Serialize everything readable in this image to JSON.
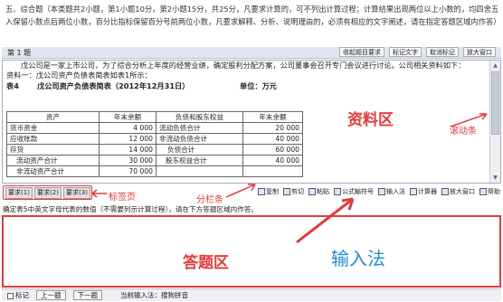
{
  "instructions": "五、综合题（本类题共2小题，第1小题10分，第2小题15分，共25分，凡要求计算的，可不列出计算过程；计算结果出现两位以上小数的，均四舍五入保留小数点后两位小数，百分比指标保留百分号前两位小数，凡要求解释、分析、说明理由的，必须有相应的文字阐述，请在指定答题区域内作答）",
  "question_bar": {
    "title": "第 1 题",
    "tools": [
      "收起题目要求",
      "标记文字",
      "取消标记",
      "放大窗口"
    ]
  },
  "material": {
    "para1": "戊公司是一家上市公司，为了综合分析上年度的经营业绩，确定股利分配方案，公司董事会召开专门会议进行讨论。公司相关资料如下：",
    "para2": "资料一：戊公司资产负债表简表如表1所示：",
    "table_label": "表4",
    "table_title": "戊公司资产负债表简表（2012年12月31日）",
    "table_unit": "单位：万元",
    "header": [
      "资产",
      "年末余额",
      "负债和股东权益",
      "年末余额"
    ],
    "rows": [
      [
        "货币资金",
        "4 000",
        "流动负债合计",
        "20 000"
      ],
      [
        "应收账款",
        "12 000",
        "非流动负债合计",
        "40 000"
      ],
      [
        "存货",
        "14 000",
        "负债合计",
        "60 000"
      ],
      [
        "流动资产合计",
        "30 000",
        "股东权益合计",
        "40 000"
      ],
      [
        "非流动资产合计",
        "70 000",
        "",
        ""
      ]
    ]
  },
  "annotations": {
    "material_area": "资料区",
    "scrollbar": "滚动条",
    "tabs": "标签页",
    "splitter": "分栏条",
    "answer_area": "答题区",
    "ime": "输入法"
  },
  "tabs": [
    "要求(1)",
    "要求(2)",
    "要求(3)"
  ],
  "answer_tools": [
    "复制",
    "剪切",
    "粘贴",
    "公式輸符号",
    "输入法",
    "计算器",
    "放大窗口",
    "帮助"
  ],
  "answer_prompt": "确定表5中英文字母代表的数值（不需要列示计算过程），请在下方答题区域内作答。",
  "status": {
    "mark": "标记",
    "prev": "上一题",
    "next": "下一题",
    "ime_label": "当前输入法：搜狗拼音"
  },
  "colors": {
    "annotation_red": "#e53a3a",
    "ime_blue": "#1e8fd6"
  }
}
